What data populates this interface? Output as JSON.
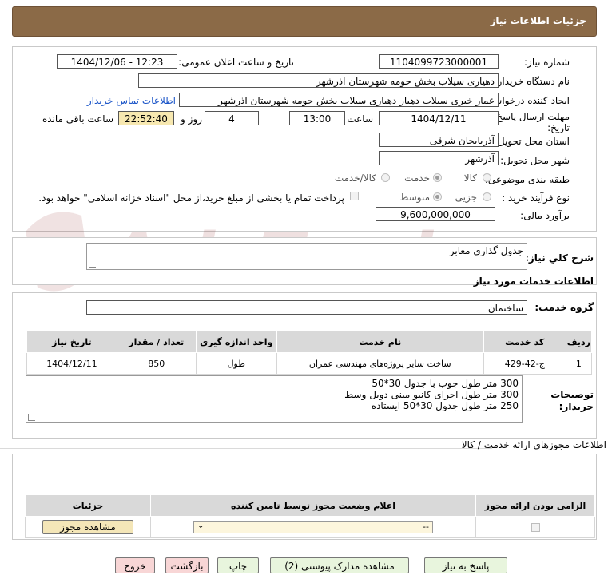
{
  "header": {
    "title": "جزئیات اطلاعات نیاز"
  },
  "form": {
    "need_number": {
      "label": "شماره نیاز:",
      "value": "1104099723000001"
    },
    "announce": {
      "label": "تاریخ و ساعت اعلان عمومی:",
      "value": "1404/12/06 - 12:23"
    },
    "buyer_org": {
      "label": "نام دستگاه خریدار:",
      "value": "دهیاری سیلاب بخش حومه شهرستان اذرشهر"
    },
    "requester": {
      "label": "ایجاد کننده درخواست:",
      "value": "عمار خیری سیلاب دهیار دهیاری سیلاب بخش حومه شهرستان اذرشهر",
      "contact_link": "اطلاعات تماس خریدار"
    },
    "deadline": {
      "label_line1": "مهلت ارسال پاسخ: تا",
      "label_line2": "تاریخ:",
      "date": "1404/12/11",
      "time_label": "ساعت",
      "time": "13:00",
      "days": "4",
      "days_label": "روز و",
      "remaining": "22:52:40",
      "remaining_label": "ساعت باقی مانده"
    },
    "province": {
      "label": "استان محل تحویل:",
      "value": "آذربایجان شرقی"
    },
    "city": {
      "label": "شهر محل تحویل:",
      "value": "آذرشهر"
    },
    "category": {
      "label": "طبقه بندی موضوعی:",
      "options": [
        "کالا",
        "خدمت",
        "کالا/خدمت"
      ],
      "selected": "خدمت"
    },
    "purchase_type": {
      "label": "نوع فرآیند خرید :",
      "options": [
        "جزیی",
        "متوسط"
      ],
      "selected": "متوسط",
      "note": "پرداخت تمام یا بخشی از مبلغ خرید،از محل \"اسناد خزانه اسلامی\" خواهد بود."
    },
    "estimate": {
      "label": "برآورد مالی:",
      "value": "9,600,000,000"
    }
  },
  "general_desc": {
    "label": "شرح کلي نیاز:",
    "value": "جدول گذاری معابر"
  },
  "services_title": "اطلاعات خدمات مورد نیاز",
  "service_group": {
    "label": "گروه خدمت:",
    "value": "ساختمان"
  },
  "items_table": {
    "headers": [
      "ردیف",
      "کد خدمت",
      "نام خدمت",
      "واحد اندازه گیری",
      "تعداد / مقدار",
      "تاریخ نیاز"
    ],
    "rows": [
      [
        "1",
        "ج-42-429",
        "ساخت سایر پروژه‌های مهندسی عمران",
        "طول",
        "850",
        "1404/12/11"
      ]
    ]
  },
  "buyer_notes": {
    "label_line1": "توضیحات",
    "label_line2": "خریدار:",
    "lines": [
      "300 متر طول جوب با جدول 30*50",
      "300 متر طول اجرای کانیو مینی دوبل وسط",
      "250 متر طول جدول 30*50 ایستاده"
    ]
  },
  "permits": {
    "section_title": "اطلاعات مجوزهای ارائه خدمت / کالا",
    "headers": [
      "الزامی بودن ارائه مجوز",
      "اعلام وضعیت مجوز توسط تامین کننده",
      "جزئیات"
    ],
    "select_value": "--",
    "view_button": "مشاهده مجوز"
  },
  "buttons": {
    "reply": "پاسخ به نیاز",
    "attachments": "مشاهده مدارک پیوستی (2)",
    "print": "چاپ",
    "back": "بازگشت",
    "exit": "خروج"
  },
  "watermark": "AriaTender.neT",
  "colors": {
    "header": "#8b6a47",
    "highlight": "#f7e8b0",
    "button_green": "#e8f5dd",
    "button_pink": "#f8d6d6",
    "link": "#1b55c8"
  }
}
